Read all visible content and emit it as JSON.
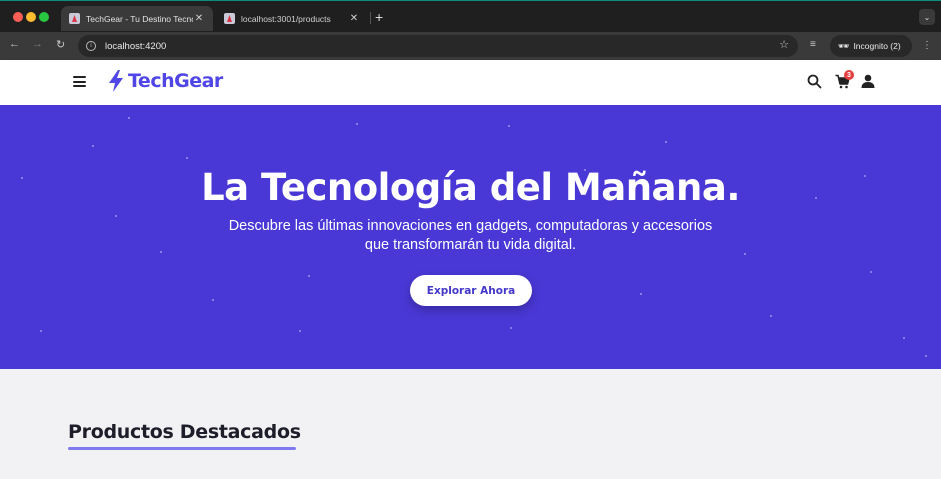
{
  "browser": {
    "tabs": [
      {
        "title": "TechGear - Tu Destino Tecnológico",
        "active": true
      },
      {
        "title": "localhost:3001/products",
        "active": false
      }
    ],
    "new_tab": "+",
    "address": "localhost:4200",
    "incognito_label": "Incognito (2)"
  },
  "site": {
    "brand": "TechGear",
    "brand_color": "#4f46e5",
    "cart_count": "3"
  },
  "hero": {
    "title": "La Tecnología del Mañana.",
    "subtitle_line1": "Descubre las últimas innovaciones en gadgets, computadoras y accesorios",
    "subtitle_line2": "que transformarán tu vida digital.",
    "cta_label": "Explorar Ahora",
    "background_color": "#4a38d6"
  },
  "section": {
    "title": "Productos Destacados"
  }
}
